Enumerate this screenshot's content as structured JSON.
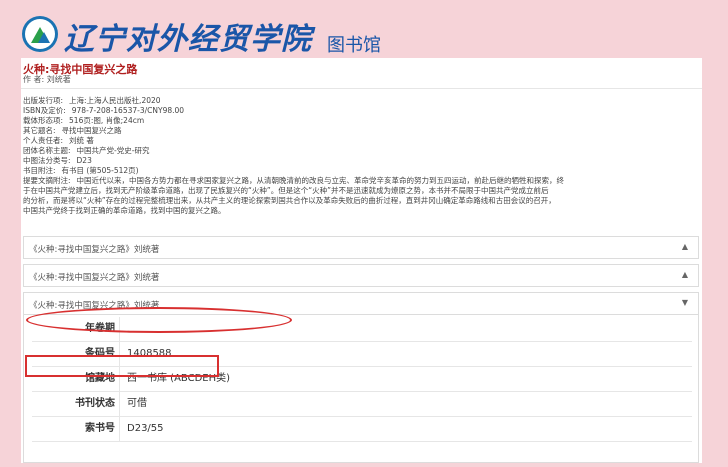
{
  "header": {
    "school_name": "辽宁对外经贸学院",
    "library_label": "图书馆"
  },
  "book": {
    "title": "火种:寻找中国复兴之路",
    "author_line": "作 者: 刘统著",
    "meta": [
      {
        "label": "出版发行项:",
        "value": "上海:上海人民出版社,2020"
      },
      {
        "label": "ISBN及定价:",
        "value": "978-7-208-16537-3/CNY98.00"
      },
      {
        "label": "载体形态项:",
        "value": "516页:图, 肖像;24cm"
      },
      {
        "label": "其它题名:",
        "value": "寻找中国复兴之路"
      },
      {
        "label": "个人责任者:",
        "value": "刘统 著"
      },
      {
        "label": "团体名称主题:",
        "value": "中国共产党-党史-研究"
      },
      {
        "label": "中图法分类号:",
        "value": "D23"
      },
      {
        "label": "书目附注:",
        "value": "有书目 (第505-512页)"
      }
    ],
    "abstract_label": "提要文摘附注:",
    "abstract_lines": [
      "中国近代以来，中国各方势力都在寻求国家复兴之路，从清朝晚清前的改良与立宪、革命党辛亥革命的努力到五四运动，前赴后继的牺牲和探索，终",
      "于在中国共产党建立后，找到无产阶级革命道路，出现了民族复兴的“火种”。但是这个“火种”并不是迅速就成为燎原之势，本书并不局限于中国共产党成立前后",
      "的分析，而是将以“火种”存在的过程完整梳理出来，从共产主义的理论探索到国共合作以及革命失败后的曲折过程，直到井冈山确定革命路线和古田会议的召开，",
      "中国共产党终于找到正确的革命道路，找到中国的复兴之路。"
    ]
  },
  "accordions": [
    {
      "label": "《火种:寻找中国复兴之路》刘统著",
      "arrow": "▲"
    },
    {
      "label": "《火种:寻找中国复兴之路》刘统著",
      "arrow": "▲"
    },
    {
      "label": "《火种:寻找中国复兴之路》刘统著",
      "arrow": "▼"
    }
  ],
  "holding": {
    "rows": [
      {
        "label": "年卷期",
        "value": ""
      },
      {
        "label": "条码号",
        "value": "1408588"
      },
      {
        "label": "馆藏地",
        "value": "西一书库 (ABCDEH类)"
      },
      {
        "label": "书刊状态",
        "value": "可借"
      },
      {
        "label": "索书号",
        "value": "D23/55"
      }
    ]
  },
  "colors": {
    "highlight": "#d83030",
    "brand": "#1a56a8"
  }
}
